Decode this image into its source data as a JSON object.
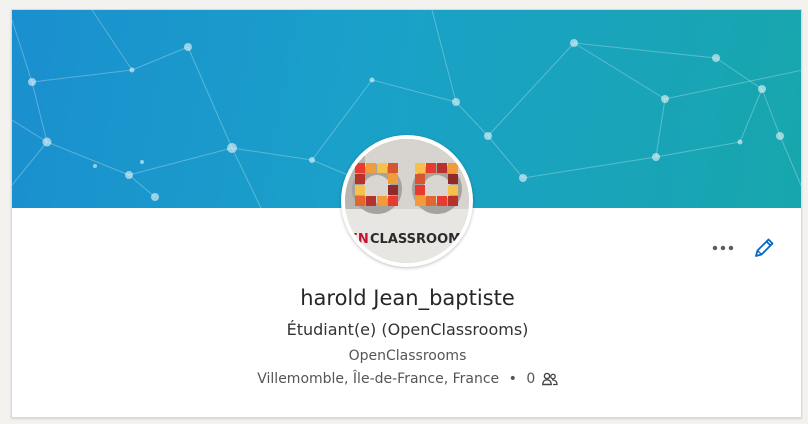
{
  "profile": {
    "name": "harold Jean_baptiste",
    "headline": "Étudiant(e) (OpenClassrooms)",
    "company": "OpenClassrooms",
    "location": "Villemomble, Île-de-France, France",
    "separator": "•",
    "connections_count": "0"
  },
  "avatar": {
    "logo_text_accent": "EN",
    "logo_text": "CLASSROOM"
  },
  "actions": {
    "more_icon": "ellipsis-icon",
    "edit_icon": "pencil-icon"
  },
  "colors": {
    "banner_start": "#1a8fcf",
    "banner_end": "#18a6ad",
    "edit_blue": "#0a66c2",
    "logo_red": "#c8102e"
  }
}
